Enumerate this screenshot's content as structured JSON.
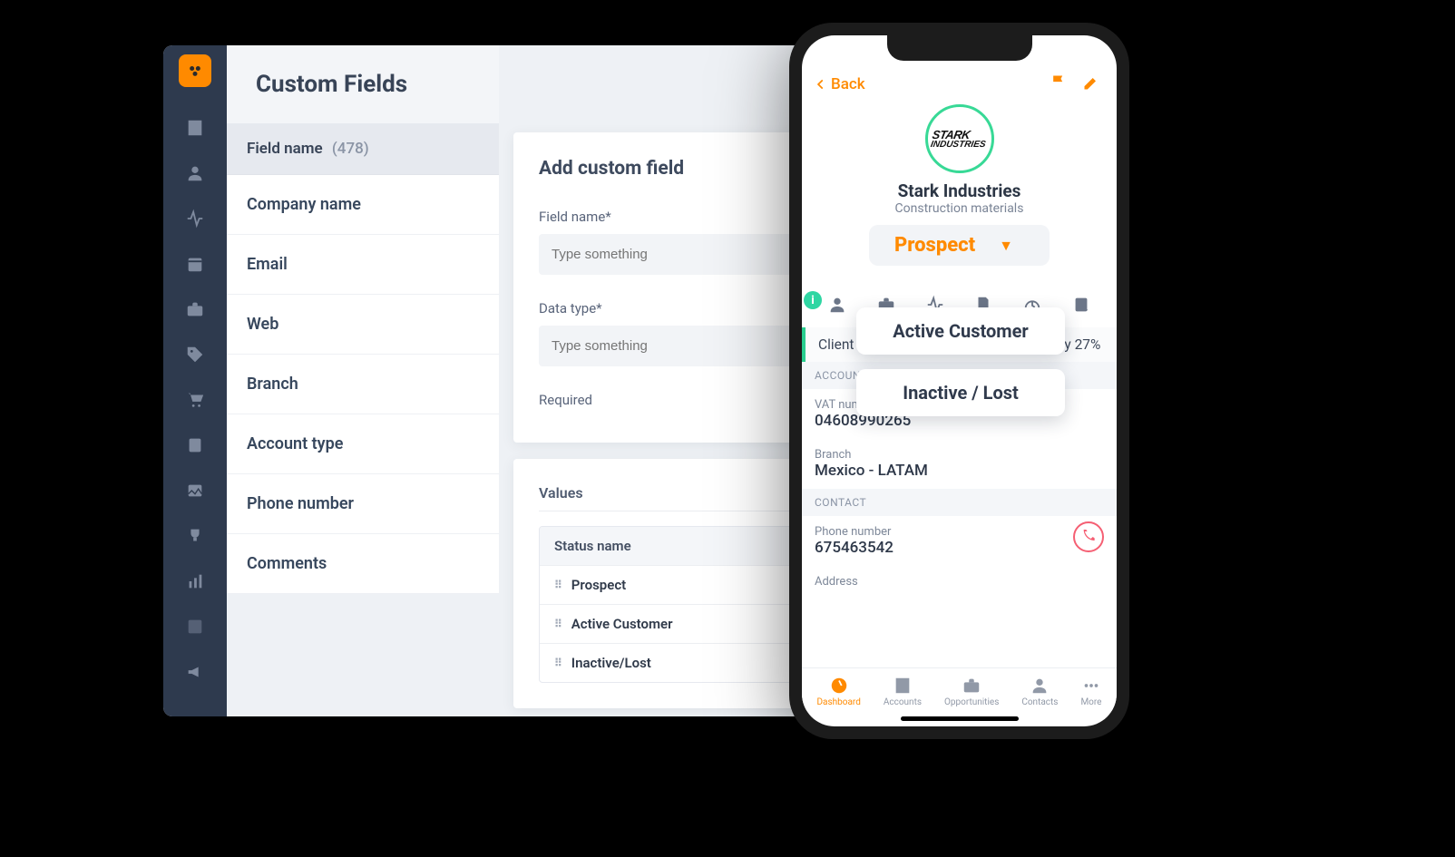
{
  "desktop": {
    "page_title": "Custom Fields",
    "field_list": {
      "header": "Field name",
      "count": "(478)",
      "items": [
        "Company name",
        "Email",
        "Web",
        "Branch",
        "Account type",
        "Phone number",
        "Comments"
      ]
    },
    "form": {
      "title": "Add custom field",
      "field_name_label": "Field name*",
      "field_name_placeholder": "Type something",
      "data_type_label": "Data type*",
      "data_type_placeholder": "Type something",
      "required_label": "Required"
    },
    "values": {
      "title": "Values",
      "column": "Status name",
      "rows": [
        "Prospect",
        "Active Customer",
        "Inactive/Lost"
      ]
    }
  },
  "phone": {
    "back": "Back",
    "company": {
      "logo_text_l1": "STARK",
      "logo_text_l2": "INDUSTRIES",
      "name": "Stark Industries",
      "subtitle": "Construction materials"
    },
    "status": {
      "current": "Prospect",
      "options": [
        "Active Customer",
        "Inactive / Lost"
      ]
    },
    "insight": "Client increased the number of orders by 27%",
    "section_account": "ACCOUNT DETAILS",
    "details": {
      "vat_label": "VAT number",
      "vat_value": "04608990265",
      "branch_label": "Branch",
      "branch_value": "Mexico - LATAM"
    },
    "section_contact": "CONTACT",
    "contact": {
      "phone_label": "Phone number",
      "phone_value": "675463542",
      "address_label": "Address"
    },
    "nav": {
      "dashboard": "Dashboard",
      "accounts": "Accounts",
      "opportunities": "Opportunities",
      "contacts": "Contacts",
      "more": "More"
    }
  }
}
